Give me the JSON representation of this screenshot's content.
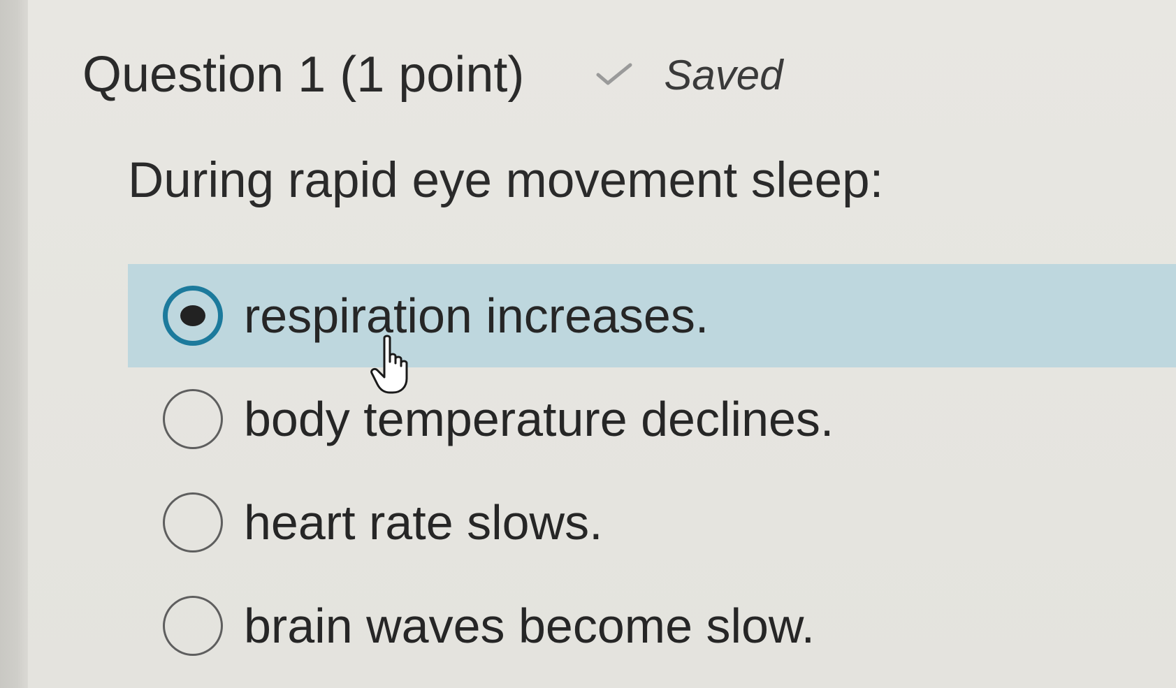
{
  "question": {
    "title": "Question 1 (1 point)",
    "status_label": "Saved",
    "status_icon": "check-icon",
    "prompt": "During rapid eye movement sleep:"
  },
  "options": [
    {
      "label": "respiration increases.",
      "selected": true
    },
    {
      "label": "body temperature declines.",
      "selected": false
    },
    {
      "label": "heart rate slows.",
      "selected": false
    },
    {
      "label": "brain waves become slow.",
      "selected": false
    }
  ],
  "colors": {
    "selected_background": "#bed7de",
    "radio_accent": "#1c7a9c",
    "page_background": "#e4e3de",
    "text": "#2a2a2a"
  },
  "pointer_icon": "hand-pointer-cursor-icon"
}
